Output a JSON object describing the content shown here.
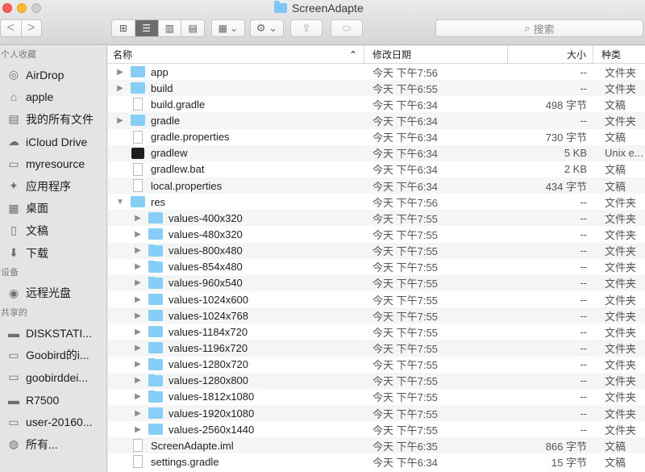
{
  "window": {
    "title": "ScreenAdapte"
  },
  "toolbar": {
    "back": "<",
    "forward": ">",
    "views": [
      "⊞",
      "☰",
      "▥",
      "▤"
    ],
    "arrange": "▦ ⌄",
    "action": "⚙ ⌄",
    "share": "⇪",
    "tags": "⬭",
    "search_placeholder": "搜索",
    "search_icon": "⌕"
  },
  "sidebar": {
    "sections": [
      {
        "label": "个人收藏",
        "items": [
          {
            "label": "AirDrop",
            "icon": "airdrop-icon",
            "glyph": "◎"
          },
          {
            "label": "apple",
            "icon": "home-icon",
            "glyph": "⌂"
          },
          {
            "label": "我的所有文件",
            "icon": "all-files-icon",
            "glyph": "▤"
          },
          {
            "label": "iCloud Drive",
            "icon": "cloud-icon",
            "glyph": "☁"
          },
          {
            "label": "myresource",
            "icon": "folder-icon",
            "glyph": "▭"
          },
          {
            "label": "应用程序",
            "icon": "applications-icon",
            "glyph": "✦"
          },
          {
            "label": "桌面",
            "icon": "desktop-icon",
            "glyph": "▦"
          },
          {
            "label": "文稿",
            "icon": "documents-icon",
            "glyph": "▯"
          },
          {
            "label": "下载",
            "icon": "downloads-icon",
            "glyph": "⬇"
          }
        ]
      },
      {
        "label": "设备",
        "items": [
          {
            "label": "远程光盘",
            "icon": "disc-icon",
            "glyph": "◉"
          }
        ]
      },
      {
        "label": "共享的",
        "items": [
          {
            "label": "DISKSTATI...",
            "icon": "server-icon",
            "glyph": "▬"
          },
          {
            "label": "Goobird的i...",
            "icon": "imac-icon",
            "glyph": "▭"
          },
          {
            "label": "goobirddei...",
            "icon": "computer-icon",
            "glyph": "▭"
          },
          {
            "label": "R7500",
            "icon": "router-icon",
            "glyph": "▬"
          },
          {
            "label": "user-20160...",
            "icon": "pc-icon",
            "glyph": "▭"
          },
          {
            "label": "所有...",
            "icon": "network-icon",
            "glyph": "◍"
          }
        ]
      }
    ]
  },
  "columns": {
    "name": "名称",
    "sort": "⌃",
    "date": "修改日期",
    "size": "大小",
    "kind": "种类"
  },
  "files": [
    {
      "name": "app",
      "type": "folder",
      "disc": "▶",
      "indent": 0,
      "date": "今天 下午7:56",
      "size": "--",
      "kind": "文件夹"
    },
    {
      "name": "build",
      "type": "folder",
      "disc": "▶",
      "indent": 0,
      "date": "今天 下午6:55",
      "size": "--",
      "kind": "文件夹"
    },
    {
      "name": "build.gradle",
      "type": "doc",
      "disc": "",
      "indent": 0,
      "date": "今天 下午6:34",
      "size": "498 字节",
      "kind": "文稿"
    },
    {
      "name": "gradle",
      "type": "folder",
      "disc": "▶",
      "indent": 0,
      "date": "今天 下午6:34",
      "size": "--",
      "kind": "文件夹"
    },
    {
      "name": "gradle.properties",
      "type": "doc",
      "disc": "",
      "indent": 0,
      "date": "今天 下午6:34",
      "size": "730 字节",
      "kind": "文稿"
    },
    {
      "name": "gradlew",
      "type": "exec",
      "disc": "",
      "indent": 0,
      "date": "今天 下午6:34",
      "size": "5 KB",
      "kind": "Unix e..."
    },
    {
      "name": "gradlew.bat",
      "type": "doc",
      "disc": "",
      "indent": 0,
      "date": "今天 下午6:34",
      "size": "2 KB",
      "kind": "文稿"
    },
    {
      "name": "local.properties",
      "type": "doc",
      "disc": "",
      "indent": 0,
      "date": "今天 下午6:34",
      "size": "434 字节",
      "kind": "文稿"
    },
    {
      "name": "res",
      "type": "folder",
      "disc": "▼",
      "indent": 0,
      "date": "今天 下午7:56",
      "size": "--",
      "kind": "文件夹"
    },
    {
      "name": "values-400x320",
      "type": "folder",
      "disc": "▶",
      "indent": 1,
      "date": "今天 下午7:55",
      "size": "--",
      "kind": "文件夹"
    },
    {
      "name": "values-480x320",
      "type": "folder",
      "disc": "▶",
      "indent": 1,
      "date": "今天 下午7:55",
      "size": "--",
      "kind": "文件夹"
    },
    {
      "name": "values-800x480",
      "type": "folder",
      "disc": "▶",
      "indent": 1,
      "date": "今天 下午7:55",
      "size": "--",
      "kind": "文件夹"
    },
    {
      "name": "values-854x480",
      "type": "folder",
      "disc": "▶",
      "indent": 1,
      "date": "今天 下午7:55",
      "size": "--",
      "kind": "文件夹"
    },
    {
      "name": "values-960x540",
      "type": "folder",
      "disc": "▶",
      "indent": 1,
      "date": "今天 下午7:55",
      "size": "--",
      "kind": "文件夹"
    },
    {
      "name": "values-1024x600",
      "type": "folder",
      "disc": "▶",
      "indent": 1,
      "date": "今天 下午7:55",
      "size": "--",
      "kind": "文件夹"
    },
    {
      "name": "values-1024x768",
      "type": "folder",
      "disc": "▶",
      "indent": 1,
      "date": "今天 下午7:55",
      "size": "--",
      "kind": "文件夹"
    },
    {
      "name": "values-1184x720",
      "type": "folder",
      "disc": "▶",
      "indent": 1,
      "date": "今天 下午7:55",
      "size": "--",
      "kind": "文件夹"
    },
    {
      "name": "values-1196x720",
      "type": "folder",
      "disc": "▶",
      "indent": 1,
      "date": "今天 下午7:55",
      "size": "--",
      "kind": "文件夹"
    },
    {
      "name": "values-1280x720",
      "type": "folder",
      "disc": "▶",
      "indent": 1,
      "date": "今天 下午7:55",
      "size": "--",
      "kind": "文件夹"
    },
    {
      "name": "values-1280x800",
      "type": "folder",
      "disc": "▶",
      "indent": 1,
      "date": "今天 下午7:55",
      "size": "--",
      "kind": "文件夹"
    },
    {
      "name": "values-1812x1080",
      "type": "folder",
      "disc": "▶",
      "indent": 1,
      "date": "今天 下午7:55",
      "size": "--",
      "kind": "文件夹"
    },
    {
      "name": "values-1920x1080",
      "type": "folder",
      "disc": "▶",
      "indent": 1,
      "date": "今天 下午7:55",
      "size": "--",
      "kind": "文件夹"
    },
    {
      "name": "values-2560x1440",
      "type": "folder",
      "disc": "▶",
      "indent": 1,
      "date": "今天 下午7:55",
      "size": "--",
      "kind": "文件夹"
    },
    {
      "name": "ScreenAdapte.iml",
      "type": "doc",
      "disc": "",
      "indent": 0,
      "date": "今天 下午6:35",
      "size": "866 字节",
      "kind": "文稿"
    },
    {
      "name": "settings.gradle",
      "type": "doc",
      "disc": "",
      "indent": 0,
      "date": "今天 下午6:34",
      "size": "15 字节",
      "kind": "文稿"
    }
  ]
}
